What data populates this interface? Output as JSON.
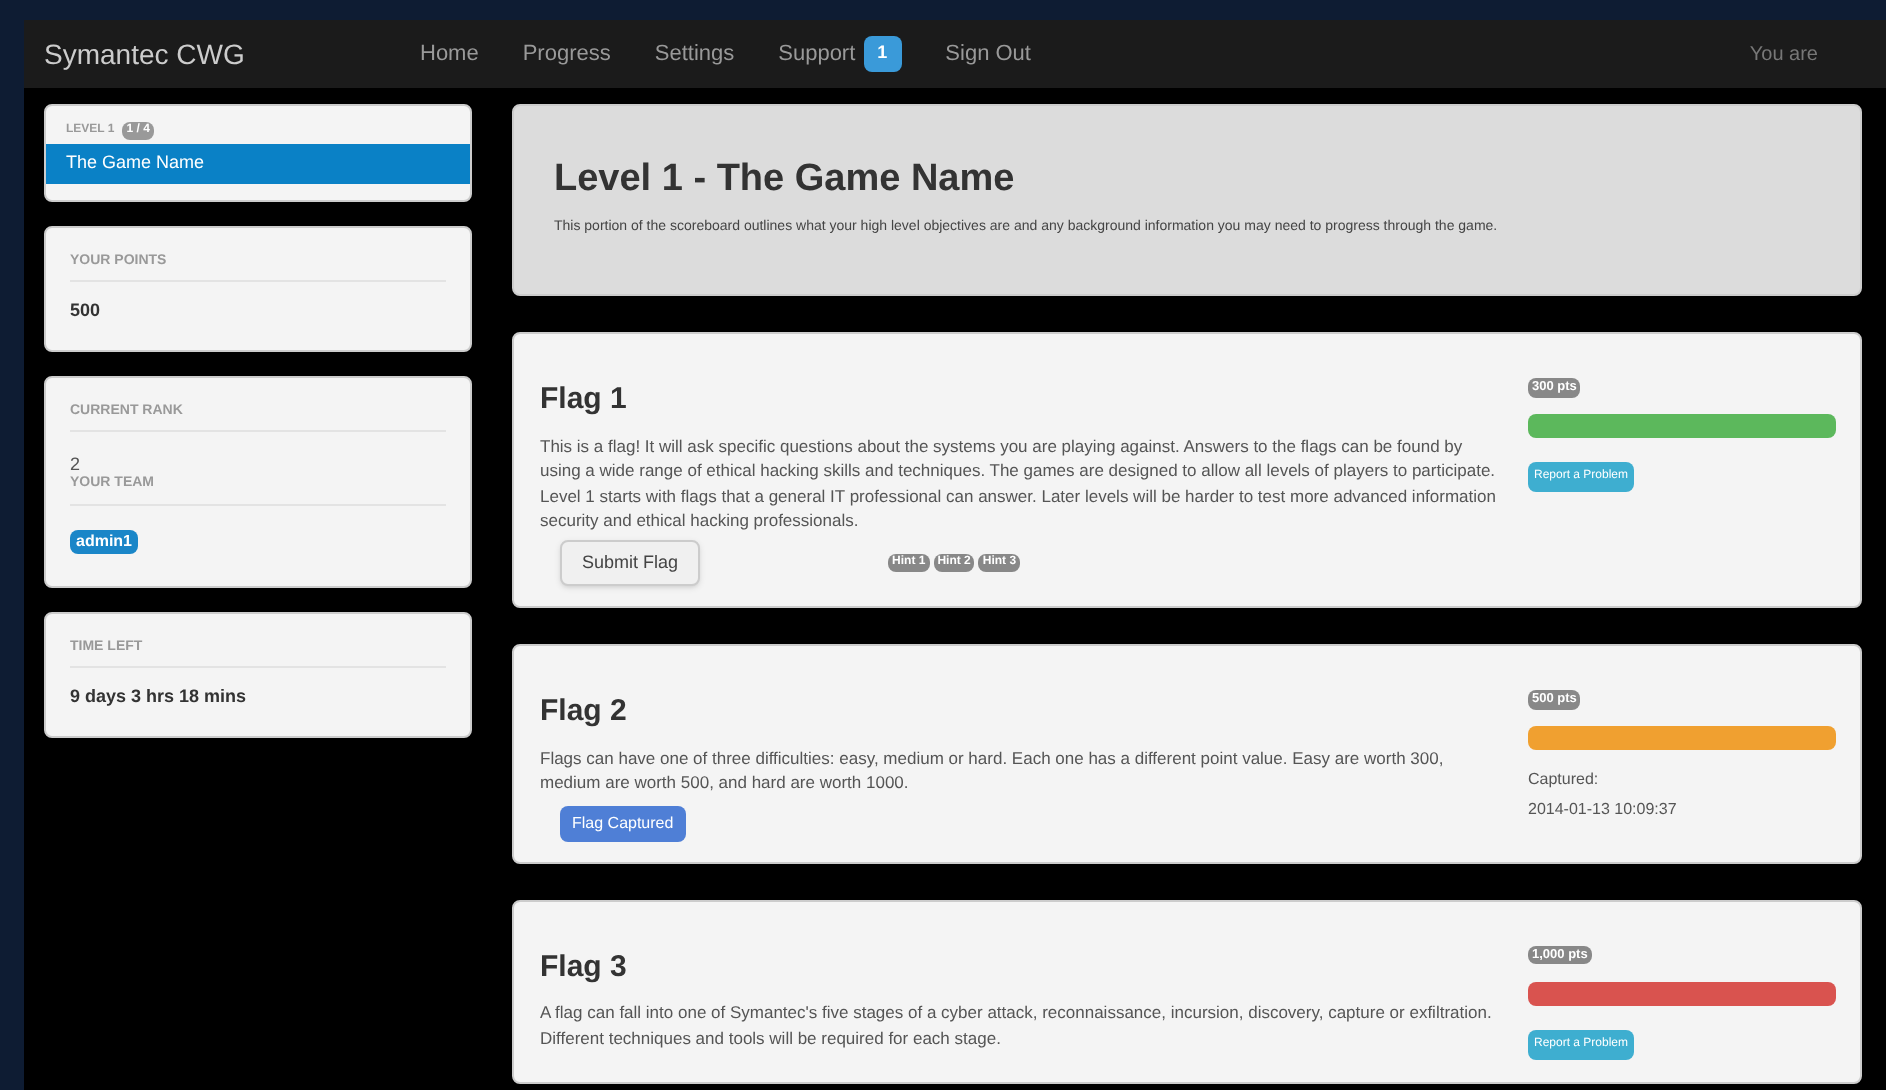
{
  "navbar": {
    "brand": "Symantec CWG",
    "links": [
      {
        "label": "Home"
      },
      {
        "label": "Progress"
      },
      {
        "label": "Settings"
      },
      {
        "label": "Support",
        "badge": "1"
      },
      {
        "label": "Sign Out"
      }
    ],
    "user": "You are"
  },
  "sidebar": {
    "level": {
      "label": "LEVEL 1",
      "badge": "1 / 4",
      "items": [
        {
          "label": "The Game Name",
          "selected": true
        }
      ]
    },
    "points": {
      "label": "YOUR POINTS",
      "value": "500"
    },
    "rank": {
      "label": "CURRENT RANK",
      "value": "2",
      "team_label": "YOUR TEAM",
      "team": "admin1"
    },
    "time": {
      "label": "TIME LEFT",
      "value": "9 days 3 hrs 18 mins"
    }
  },
  "header": {
    "title": "Level 1 - The Game Name",
    "text": "This portion of the scoreboard outlines what your high level objectives are and any background information you may need to progress through the game."
  },
  "flags": [
    {
      "title": "Flag 1",
      "text": "This is a flag! It will ask specific questions about the systems you are playing against. Answers to the flags can be found by using a wide range of ethical hacking skills and techniques. The games are designed to allow all levels of players to participate. Level 1 starts with flags that a general IT professional can answer. Later levels will be harder to test more advanced information security and ethical hacking professionals.",
      "points": "300 pts",
      "color": "#5cb85c",
      "button": {
        "kind": "submit",
        "label": "Submit Flag"
      },
      "hints": [
        "Hint 1",
        "Hint 2",
        "Hint 3"
      ],
      "report": "Report a Problem"
    },
    {
      "title": "Flag 2",
      "text": "Flags can have one of three difficulties: easy, medium or hard. Each one has a different point value. Easy are worth 300, medium are worth 500, and hard are worth 1000.",
      "points": "500 pts",
      "color": "#f0a030",
      "button": {
        "kind": "captured",
        "label": "Flag Captured"
      },
      "captured_label": "Captured:",
      "captured_time": "2014-01-13 10:09:37"
    },
    {
      "title": "Flag 3",
      "text": "A flag can fall into one of Symantec's five stages of a cyber attack, reconnaissance, incursion, discovery, capture or exfiltration. Different techniques and tools will be required for each stage.",
      "points": "1,000 pts",
      "color": "#d9534f",
      "report": "Report a Problem"
    }
  ]
}
